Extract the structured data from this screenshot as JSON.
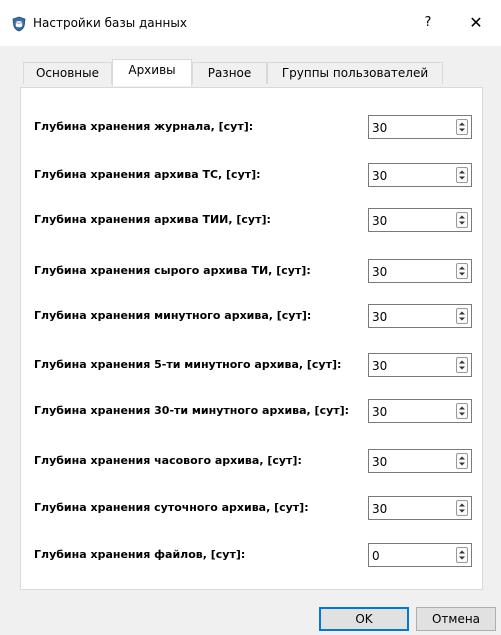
{
  "window": {
    "title": "Настройки базы данных",
    "help_label": "?",
    "close_label": "✕"
  },
  "tabs": [
    {
      "label": "Основные",
      "active": false
    },
    {
      "label": "Архивы",
      "active": true
    },
    {
      "label": "Разное",
      "active": false
    },
    {
      "label": "Группы пользователей",
      "active": false
    }
  ],
  "settings": [
    {
      "label": "Глубина хранения журнала, [сут]:",
      "value": "30"
    },
    {
      "label": "Глубина хранения архива ТС, [сут]:",
      "value": "30"
    },
    {
      "label": "Глубина хранения архива ТИИ, [сут]:",
      "value": "30"
    },
    {
      "label": "Глубина хранения сырого архива ТИ, [сут]:",
      "value": "30"
    },
    {
      "label": "Глубина хранения минутного архива, [сут]:",
      "value": "30"
    },
    {
      "label": "Глубина хранения 5-ти минутного архива, [сут]:",
      "value": "30"
    },
    {
      "label": "Глубина хранения 30-ти минутного архива, [сут]:",
      "value": "30"
    },
    {
      "label": "Глубина хранения часового архива, [сут]:",
      "value": "30"
    },
    {
      "label": "Глубина хранения суточного архива, [сут]:",
      "value": "30"
    },
    {
      "label": "Глубина хранения файлов, [сут]:",
      "value": "0"
    }
  ],
  "buttons": {
    "ok_label": "OK",
    "cancel_label": "Отмена"
  },
  "colors": {
    "accent": "#0078d7",
    "icon_shield": "#3a6ea5"
  },
  "icons": {
    "app": "database-shield-icon",
    "spinner": "spin-arrows-icon"
  }
}
